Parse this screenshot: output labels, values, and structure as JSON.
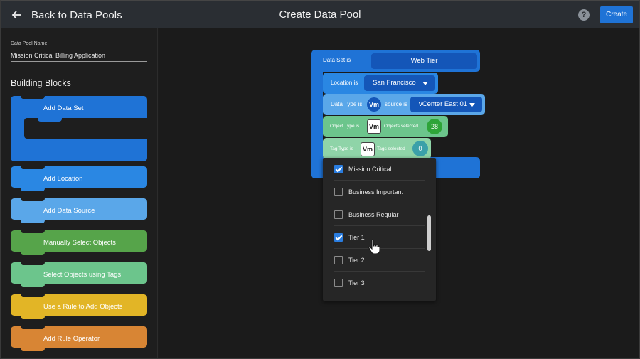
{
  "header": {
    "back_label": "Back to Data Pools",
    "title": "Create Data Pool",
    "help_icon": "?",
    "create_label": "Create"
  },
  "sidebar": {
    "data_pool_name_label": "Data Pool Name",
    "data_pool_name_value": "Mission Critical Billing Application",
    "building_blocks_title": "Building Blocks",
    "blocks": [
      {
        "label": "Add Data Set",
        "color": "#1f73d6"
      },
      {
        "label": "Add Location",
        "color": "#2a87e3"
      },
      {
        "label": "Add Data Source",
        "color": "#5aa7e9"
      },
      {
        "label": "Manually Select Objects",
        "color": "#56a44a"
      },
      {
        "label": "Select Objects using Tags",
        "color": "#6cc58c"
      },
      {
        "label": "Use a Rule to Add Objects",
        "color": "#e2b526"
      },
      {
        "label": "Add Rule Operator",
        "color": "#d88534"
      }
    ]
  },
  "canvas": {
    "data_set_label": "Data Set is",
    "data_set_value": "Web Tier",
    "location_label": "Location is",
    "location_value": "San Francisco",
    "data_type_label": "Data Type is",
    "data_type_badge": "Vm",
    "source_label": "source is",
    "source_value": "vCenter East 01",
    "object_type_label": "Object Type is",
    "object_type_badge": "Vm",
    "objects_selected_label": "Objects selected",
    "objects_selected_count": "28",
    "tag_type_label": "Tag Type is",
    "tag_type_badge": "Vm",
    "tags_selected_label": "Tags selected",
    "tags_selected_count": "0"
  },
  "tag_options": [
    {
      "label": "Mission Critical",
      "checked": true
    },
    {
      "label": "Business Important",
      "checked": false
    },
    {
      "label": "Business Regular",
      "checked": false
    },
    {
      "label": "Tier 1",
      "checked": true
    },
    {
      "label": "Tier 2",
      "checked": false
    },
    {
      "label": "Tier 3",
      "checked": false
    }
  ]
}
